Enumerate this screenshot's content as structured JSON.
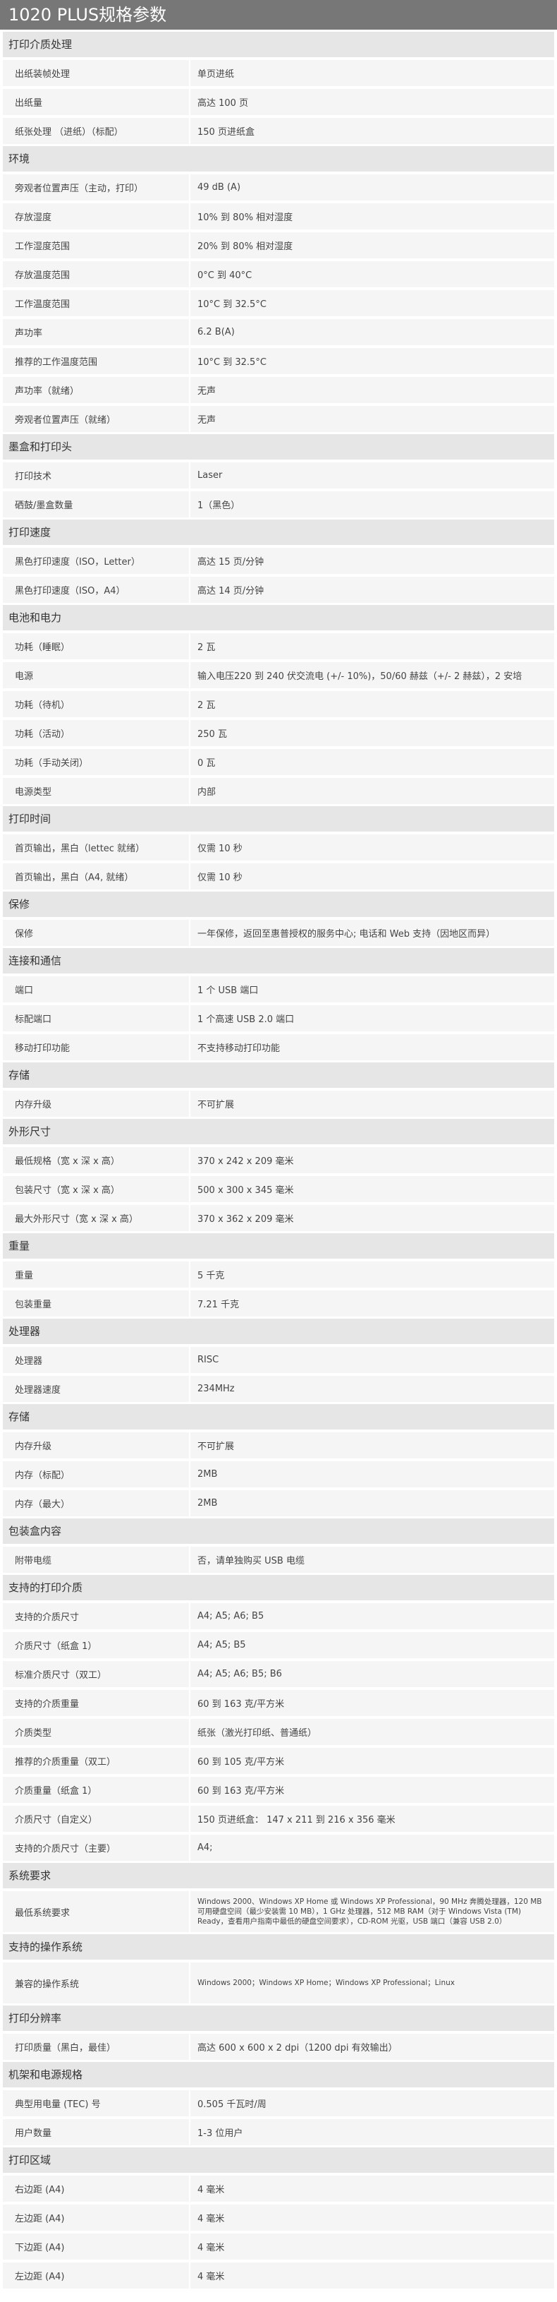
{
  "page_title": "1020 PLUS规格参数",
  "sections": [
    {
      "title": "打印介质处理",
      "rows": [
        {
          "label": "出纸装帧处理",
          "value": "单页进纸"
        },
        {
          "label": "出纸量",
          "value": "高达 100 页"
        },
        {
          "label": "纸张处理 （进纸）（标配）",
          "value": "150 页进纸盒"
        }
      ]
    },
    {
      "title": "环境",
      "rows": [
        {
          "label": "旁观者位置声压（主动，打印）",
          "value": "49 dB (A)"
        },
        {
          "label": "存放湿度",
          "value": "10% 到 80% 相对湿度"
        },
        {
          "label": "工作湿度范围",
          "value": "20% 到 80% 相对湿度"
        },
        {
          "label": "存放温度范围",
          "value": "0°C 到 40°C"
        },
        {
          "label": "工作温度范围",
          "value": "10°C 到 32.5°C"
        },
        {
          "label": "声功率",
          "value": "6.2 B(A)"
        },
        {
          "label": "推荐的工作温度范围",
          "value": "10°C 到 32.5°C"
        },
        {
          "label": "声功率（就绪）",
          "value": "无声"
        },
        {
          "label": "旁观者位置声压（就绪）",
          "value": "无声"
        }
      ]
    },
    {
      "title": "墨盒和打印头",
      "rows": [
        {
          "label": "打印技术",
          "value": "Laser"
        },
        {
          "label": "硒鼓/墨盒数量",
          "value": "1（黑色）"
        }
      ]
    },
    {
      "title": "打印速度",
      "rows": [
        {
          "label": "黑色打印速度（ISO，Letter）",
          "value": "高达 15 页/分钟"
        },
        {
          "label": "黑色打印速度（ISO，A4）",
          "value": "高达 14 页/分钟"
        }
      ]
    },
    {
      "title": "电池和电力",
      "rows": [
        {
          "label": "功耗（睡眠）",
          "value": "2 瓦"
        },
        {
          "label": "电源",
          "value": "输入电压220 到 240 伏交流电 (+/- 10%)，50/60 赫兹（+/- 2 赫兹），2 安培"
        },
        {
          "label": "功耗（待机）",
          "value": "2 瓦"
        },
        {
          "label": "功耗（活动）",
          "value": "250 瓦"
        },
        {
          "label": "功耗（手动关闭）",
          "value": "0 瓦"
        },
        {
          "label": "电源类型",
          "value": "内部"
        }
      ]
    },
    {
      "title": "打印时间",
      "rows": [
        {
          "label": "首页输出，黑白（lettec 就绪）",
          "value": "仅需 10 秒"
        },
        {
          "label": "首页输出，黑白（A4, 就绪）",
          "value": "仅需 10 秒"
        }
      ]
    },
    {
      "title": "保修",
      "rows": [
        {
          "label": "保修",
          "value": "一年保修，返回至惠普授权的服务中心; 电话和 Web 支持（因地区而异）"
        }
      ]
    },
    {
      "title": "连接和通信",
      "rows": [
        {
          "label": "端口",
          "value": "1 个 USB 端口"
        },
        {
          "label": "标配端口",
          "value": "1 个高速 USB 2.0 端口"
        },
        {
          "label": "移动打印功能",
          "value": "不支持移动打印功能"
        }
      ]
    },
    {
      "title": "存储",
      "rows": [
        {
          "label": "内存升级",
          "value": "不可扩展"
        }
      ]
    },
    {
      "title": "外形尺寸",
      "rows": [
        {
          "label": "最低规格（宽 x 深 x 高）",
          "value": "370 x 242 x 209 毫米"
        },
        {
          "label": "包装尺寸（宽 x 深 x 高）",
          "value": "500 x 300 x 345 毫米"
        },
        {
          "label": "最大外形尺寸（宽 x 深 x 高）",
          "value": "370 x 362 x 209 毫米"
        }
      ]
    },
    {
      "title": "重量",
      "rows": [
        {
          "label": "重量",
          "value": "5 千克"
        },
        {
          "label": "包装重量",
          "value": "7.21 千克"
        }
      ]
    },
    {
      "title": "处理器",
      "rows": [
        {
          "label": "处理器",
          "value": "RISC"
        },
        {
          "label": "处理器速度",
          "value": "234MHz"
        }
      ]
    },
    {
      "title": "存储",
      "rows": [
        {
          "label": "内存升级",
          "value": "不可扩展"
        },
        {
          "label": "内存（标配）",
          "value": "2MB"
        },
        {
          "label": "内存（最大）",
          "value": "2MB"
        }
      ]
    },
    {
      "title": "包装盒内容",
      "rows": [
        {
          "label": "附带电缆",
          "value": "否，请单独购买 USB 电缆"
        }
      ]
    },
    {
      "title": "支持的打印介质",
      "rows": [
        {
          "label": "支持的介质尺寸",
          "value": "A4; A5; A6; B5"
        },
        {
          "label": "介质尺寸（纸盒 1）",
          "value": "A4; A5; B5"
        },
        {
          "label": "标准介质尺寸（双工）",
          "value": "A4; A5; A6; B5; B6"
        },
        {
          "label": "支持的介质重量",
          "value": "60 到 163 克/平方米"
        },
        {
          "label": "介质类型",
          "value": "纸张（激光打印纸、普通纸）"
        },
        {
          "label": "推荐的介质重量（双工）",
          "value": "60 到 105 克/平方米"
        },
        {
          "label": "介质重量（纸盒 1）",
          "value": "60 到 163 克/平方米"
        },
        {
          "label": "介质尺寸（自定义）",
          "value": "150 页进纸盒： 147 x 211 到 216 x 356 毫米"
        },
        {
          "label": "支持的介质尺寸（主要）",
          "value": "A4;"
        }
      ]
    },
    {
      "title": "系统要求",
      "rows": [
        {
          "label": "最低系统要求",
          "tall": true,
          "value": "Windows 2000、Windows XP Home 或 Windows XP Professional，90 MHz 奔腾处理器，120 MB 可用硬盘空间（最少安装需 10 MB），1 GHz 处理器，512 MB RAM（对于 Windows Vista (TM) Ready，查看用户指南中最低的硬盘空间要求），CD-ROM 光驱，USB 端口（兼容 USB 2.0）"
        }
      ]
    },
    {
      "title": "支持的操作系统",
      "rows": [
        {
          "label": "兼容的操作系统",
          "tall": true,
          "value": "Windows 2000；Windows XP Home；Windows XP Professional；Linux"
        }
      ]
    },
    {
      "title": "打印分辨率",
      "rows": [
        {
          "label": "打印质量（黑白，最佳）",
          "value": "高达 600 x 600 x 2 dpi（1200 dpi 有效输出）"
        }
      ]
    },
    {
      "title": "机架和电源规格",
      "rows": [
        {
          "label": "典型用电量 (TEC) 号",
          "value": "0.505 千瓦时/周"
        },
        {
          "label": "用户数量",
          "value": "1-3 位用户"
        }
      ]
    },
    {
      "title": "打印区域",
      "rows": [
        {
          "label": "右边距 (A4)",
          "value": "4 毫米"
        },
        {
          "label": "左边距 (A4)",
          "value": "4 毫米"
        },
        {
          "label": "下边距 (A4)",
          "value": "4 毫米"
        },
        {
          "label": "左边距 (A4)",
          "value": "4 毫米"
        }
      ]
    }
  ]
}
